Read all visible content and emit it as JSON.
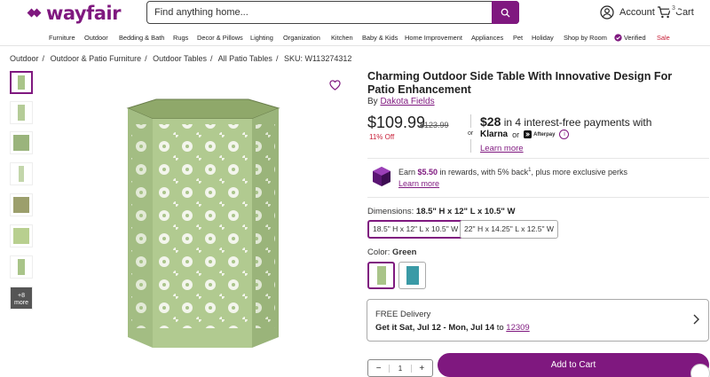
{
  "header": {
    "brand": "wayfair",
    "search_placeholder": "Find anything home...",
    "account_label": "Account",
    "cart_label": "Cart",
    "cart_count": "3"
  },
  "nav": [
    "Furniture",
    "Outdoor",
    "Bedding & Bath",
    "Rugs",
    "Decor & Pillows",
    "Lighting",
    "Organization",
    "Kitchen",
    "Baby & Kids",
    "Home Improvement",
    "Appliances",
    "Pet",
    "Holiday",
    "Shop by Room",
    "Verified",
    "Sale"
  ],
  "breadcrumb": [
    "Outdoor",
    "Outdoor & Patio Furniture",
    "Outdoor Tables",
    "All Patio Tables",
    "SKU: W113274312"
  ],
  "thumbs": {
    "more_count": "+8",
    "more_label": "more"
  },
  "product": {
    "title": "Charming Outdoor Side Table With Innovative Design For Patio Enhancement",
    "by": "By",
    "brand": "Dakota Fields",
    "price": "$109.99",
    "old_price": "$123.99",
    "discount": "11% Off",
    "or": "or",
    "installment_amount": "$28",
    "installment_text": " in 4 interest-free payments with",
    "klarna": "Klarna",
    "or2": "or",
    "afterpay": "Afterpay",
    "learn_more": "Learn more",
    "reward_pre": "Earn ",
    "reward_amount": "$5.50",
    "reward_post": " in rewards, with 5% back",
    "reward_sup": "1",
    "reward_tail": ", plus more exclusive perks",
    "learn_more2": "Learn more",
    "dimensions_label": "Dimensions: ",
    "dimensions_value": "18.5\" H x 12\" L x 10.5\" W",
    "options": [
      "18.5\" H x 12\" L x 10.5\" W",
      "22\" H x 14.25\" L x 12.5\" W"
    ],
    "color_label": "Color: ",
    "color_value": "Green",
    "delivery_title": "FREE Delivery",
    "delivery_prefix": "Get it ",
    "delivery_dates": "Sat, Jul 12 - Mon, Jul 14",
    "delivery_to": " to ",
    "delivery_zip": "12309",
    "quantity": "1",
    "add_to_cart": "Add to Cart"
  },
  "colors": {
    "brand": "#7f187f",
    "sale": "#c71d36",
    "product_green": "#a9c489",
    "alt_teal": "#3a9aa6"
  }
}
